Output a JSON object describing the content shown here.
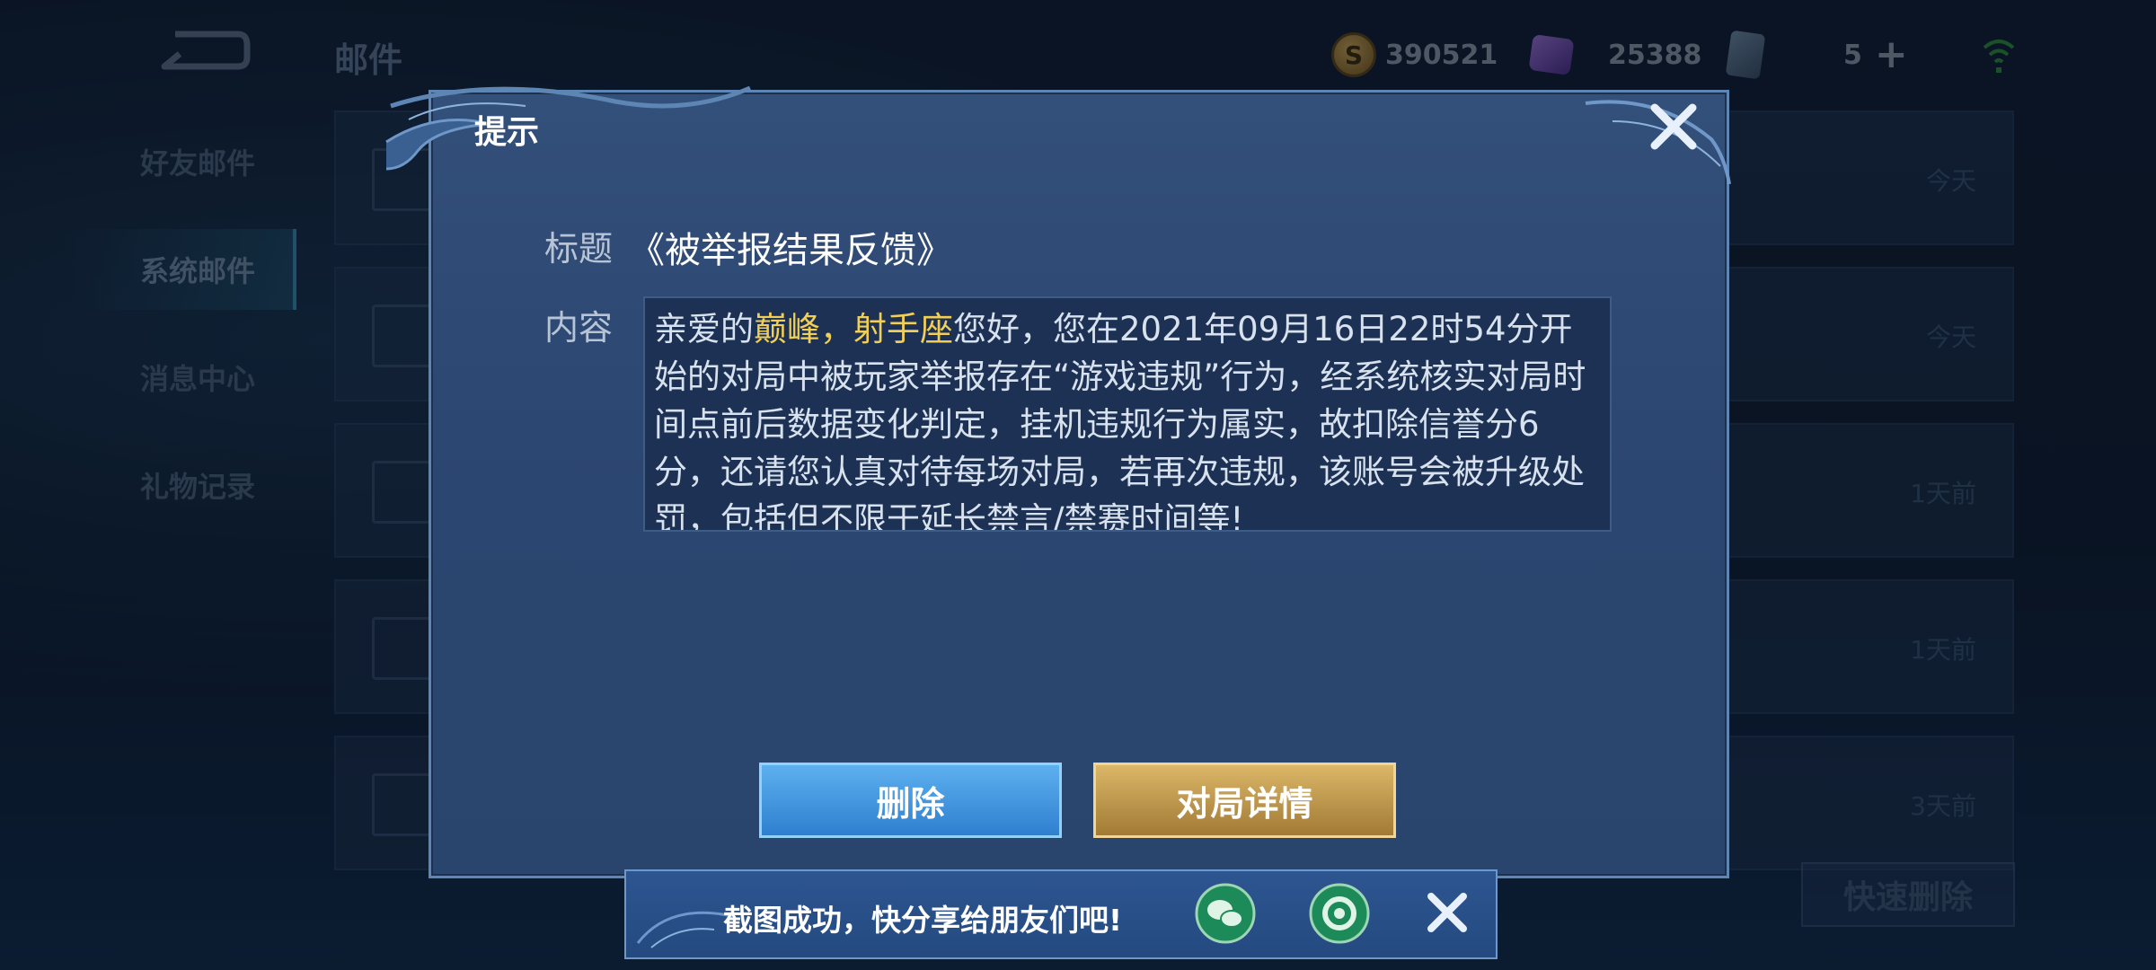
{
  "page": {
    "title": "邮件"
  },
  "currencies": {
    "coins": "390521",
    "gems": "25388",
    "tickets": "5",
    "plus": "+"
  },
  "sidebar": {
    "items": [
      {
        "label": "好友邮件"
      },
      {
        "label": "系统邮件"
      },
      {
        "label": "消息中心"
      },
      {
        "label": "礼物记录"
      }
    ]
  },
  "mail_list": {
    "times": [
      "今天",
      "今天",
      "1天前",
      "1天前",
      "3天前"
    ],
    "quick_delete_label": "快速删除"
  },
  "dialog": {
    "header": "提示",
    "title_label": "标题",
    "title_value": "《被举报结果反馈》",
    "content_label": "内容",
    "content_greeting": "亲爱的",
    "content_name": "巅峰，射手座",
    "content_body": "您好，您在2021年09月16日22时54分开始的对局中被玩家举报存在“游戏违规”行为，经系统核实对局时间点前后数据变化判定，挂机违规行为属实，故扣除信誉分6分，还请您认真对待每场对局，若再次违规，该账号会被升级处罚，包括但不限于延长禁言/禁赛时间等!",
    "delete_label": "删除",
    "detail_label": "对局详情"
  },
  "toast": {
    "message": "截图成功，快分享给朋友们吧!"
  },
  "colors": {
    "highlight": "#f1cf57",
    "dialog_bg": "#2b4670",
    "delete_btn": "#3a8fdd",
    "detail_btn": "#c49a4b"
  }
}
